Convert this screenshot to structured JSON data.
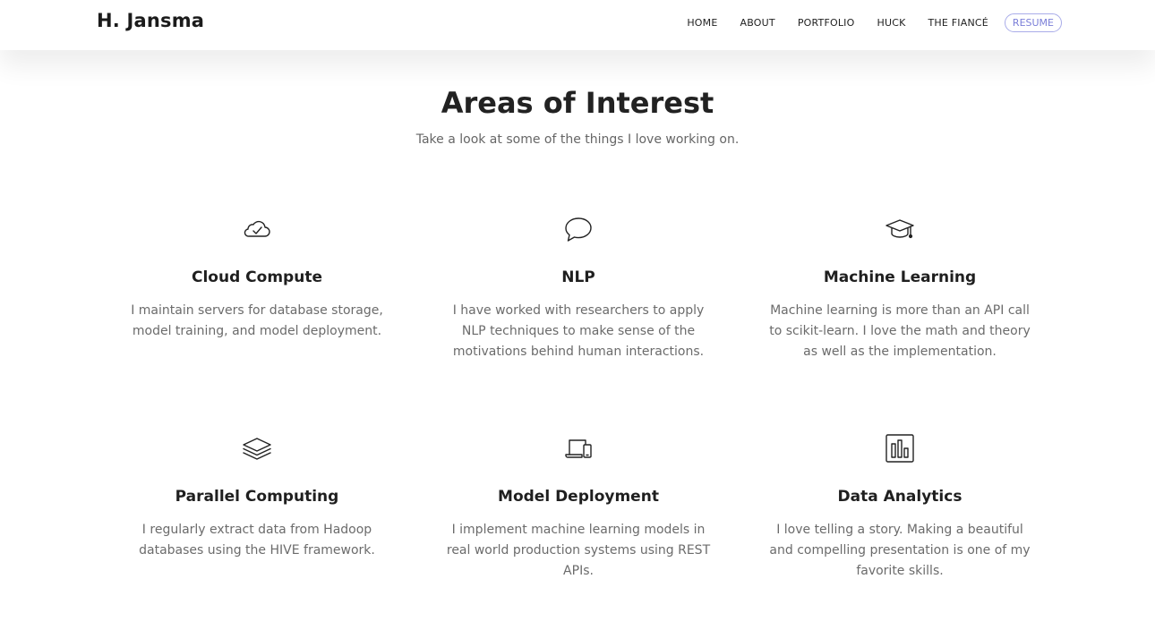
{
  "nav": {
    "brand": "H. Jansma",
    "links": [
      "HOME",
      "ABOUT",
      "PORTFOLIO",
      "HUCK",
      "THE FIANCÉ"
    ],
    "resume": "RESUME"
  },
  "hero": {
    "title": "Areas of Interest",
    "subtitle": "Take a look at some of the things I love working on."
  },
  "cards": [
    {
      "icon": "cloud-check-icon",
      "title": "Cloud Compute",
      "text": "I maintain servers for database storage, model training, and model deployment."
    },
    {
      "icon": "speech-bubble-icon",
      "title": "NLP",
      "text": "I have worked with researchers to apply NLP techniques to make sense of the motivations behind human interactions."
    },
    {
      "icon": "graduation-cap-icon",
      "title": "Machine Learning",
      "text": "Machine learning is more than an API call to scikit-learn. I love the math and theory as well as the implementation."
    },
    {
      "icon": "layers-icon",
      "title": "Parallel Computing",
      "text": "I regularly extract data from Hadoop databases using the HIVE framework."
    },
    {
      "icon": "laptop-phone-icon",
      "title": "Model Deployment",
      "text": "I implement machine learning models in real world production systems using REST APIs."
    },
    {
      "icon": "bar-chart-icon",
      "title": "Data Analytics",
      "text": "I love telling a story. Making a beautiful and compelling presentation is one of my favorite skills."
    }
  ],
  "colors": {
    "accent": "#7b7fd8",
    "heading": "#222222",
    "body_text": "#6b6b6b"
  }
}
